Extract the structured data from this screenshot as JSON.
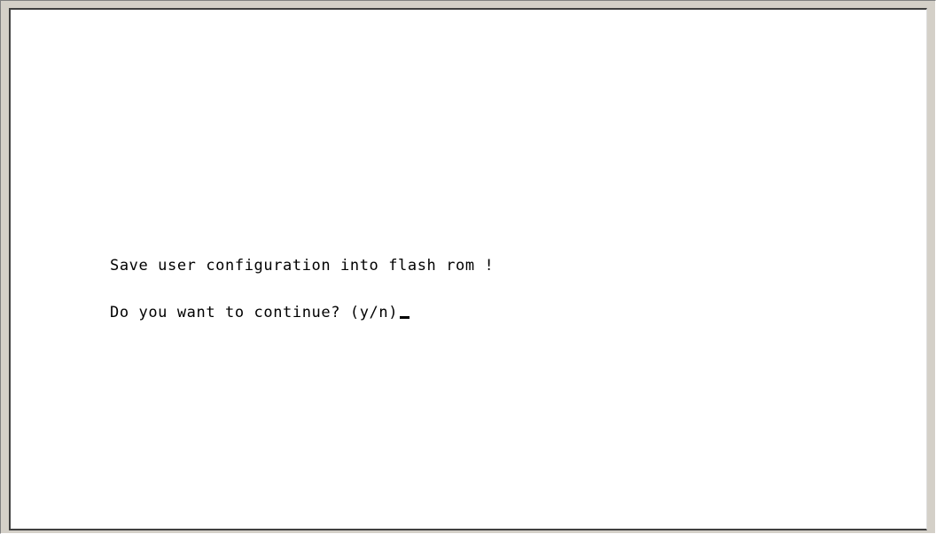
{
  "terminal": {
    "lines": [
      "Save user configuration into flash rom !",
      "Do you want to continue? (y/n)"
    ]
  }
}
